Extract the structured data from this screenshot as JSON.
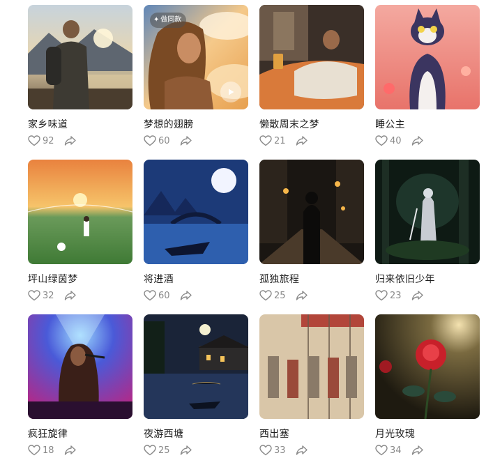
{
  "accent": "#8a8a8a",
  "badge": {
    "label": "做同款",
    "icon": "sparkle-icon"
  },
  "cards": [
    {
      "title": "家乡味道",
      "likes": "92",
      "scene": "hiker-sunset"
    },
    {
      "title": "梦想的翅膀",
      "likes": "60",
      "scene": "girl-clouds",
      "badge": true,
      "video": true
    },
    {
      "title": "懒散周末之梦",
      "likes": "21",
      "scene": "man-lounging"
    },
    {
      "title": "睡公主",
      "likes": "40",
      "scene": "cartoon-cat"
    },
    {
      "title": "坪山绿茵梦",
      "likes": "32",
      "scene": "football-field"
    },
    {
      "title": "将进酒",
      "likes": "60",
      "scene": "moon-bridge"
    },
    {
      "title": "孤独旅程",
      "likes": "25",
      "scene": "night-street"
    },
    {
      "title": "归来依旧少年",
      "likes": "23",
      "scene": "forest-swordsman"
    },
    {
      "title": "疯狂旋律",
      "likes": "18",
      "scene": "concert-singer"
    },
    {
      "title": "夜游西塘",
      "likes": "25",
      "scene": "water-town"
    },
    {
      "title": "西出塞",
      "likes": "33",
      "scene": "ancient-soldiers"
    },
    {
      "title": "月光玫瑰",
      "likes": "34",
      "scene": "red-rose"
    }
  ]
}
